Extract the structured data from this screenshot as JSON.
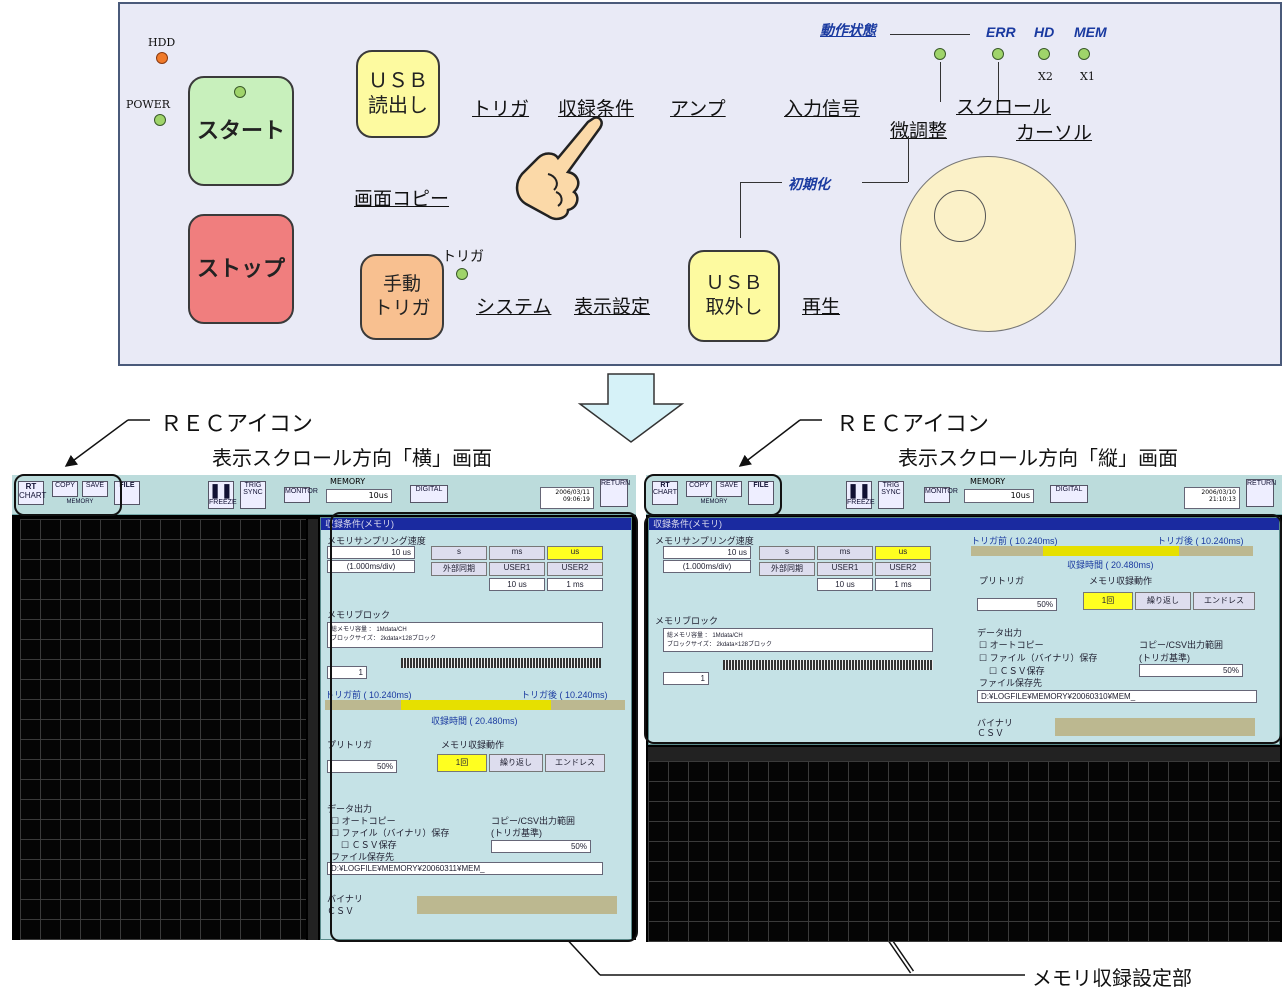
{
  "panel": {
    "hdd_label": "HDD",
    "power_label": "POWER",
    "start": "スタート",
    "stop": "ストップ",
    "usb_read": "ＵＳＢ\n読出し",
    "manual_trigger": "手動\nトリガ",
    "trigger_led_label": "トリガ",
    "usb_remove": "ＵＳＢ\n取外し",
    "links": {
      "trigger": "トリガ",
      "recording": "収録条件",
      "amp": "アンプ",
      "input_signal": "入力信号",
      "screen_copy": "画面コピー",
      "system": "システム",
      "display_settings": "表示設定",
      "playback": "再生",
      "fine_adjust": "微調整",
      "scroll": "スクロール",
      "cursor": "カーソル"
    },
    "status_header": "動作状態",
    "err": "ERR",
    "hd": "HD",
    "mem": "MEM",
    "x2": "X2",
    "x1": "X1",
    "init": "初期化"
  },
  "captions": {
    "rec_icon_left": "ＲＥＣアイコン",
    "scroll_h": "表示スクロール方向「横」画面",
    "rec_icon_right": "ＲＥＣアイコン",
    "scroll_v": "表示スクロール方向「縦」画面",
    "memory_settings": "メモリ収録設定部"
  },
  "shot": {
    "rt": "RT",
    "chart": "CHART",
    "copy": "COPY",
    "save": "SAVE",
    "file": "FILE",
    "memory_tab": "MEMORY",
    "freeze": "FREEZE",
    "trig_sync": "TRIG SYNC",
    "monitor": "MONITOR",
    "memory": "MEMORY",
    "time_value": "10us",
    "digital": "DIGITAL",
    "date_left": "2006/03/11\n09:06:19",
    "date_right": "2006/03/10\n21:10:13",
    "return": "RETURN",
    "cfg_title": "収録条件(メモリ)",
    "sampling_title": "メモリサンプリング速度",
    "sampling_value": "10 us",
    "per_div": "(1.000ms/div)",
    "unit_s": "s",
    "unit_ms": "ms",
    "unit_us": "us",
    "ext_sync": "外部同期",
    "user1": "USER1",
    "user2": "USER2",
    "user1_val": "10 us",
    "user2_val": "1 ms",
    "block_title": "メモリブロック",
    "block_line1": "総メモリ容量 ： 1Mdata/CH",
    "block_line2": "ブロックサイズ： 2kdata×128ブロック",
    "block_num": "1",
    "pre_trigger_label": "トリガ前",
    "pre_trigger_val": "( 10.240ms)",
    "post_trigger_label": "トリガ後",
    "post_trigger_val": "( 10.240ms)",
    "rec_time_label": "収録時間",
    "rec_time_val": "( 20.480ms)",
    "pretrigger_title": "プリトリガ",
    "pretrigger_val": "50%",
    "action_title": "メモリ収録動作",
    "once": "1回",
    "repeat": "繰り返し",
    "endless": "エンドレス",
    "output_title": "データ出力",
    "auto_copy": "オートコピー",
    "file_save": "ファイル（バイナリ）保存",
    "csv_save": "ＣＳＶ保存",
    "save_dest": "ファイル保存先",
    "path_left": "D:¥LOGFILE¥MEMORY¥20060311¥MEM_",
    "path_right": "D:¥LOGFILE¥MEMORY¥20060310¥MEM_",
    "range_title": "コピー/CSV出力範囲",
    "range_sub": "(トリガ基準)",
    "range_val": "50%",
    "binary": "バイナリ",
    "csv": "ＣＳＶ"
  }
}
